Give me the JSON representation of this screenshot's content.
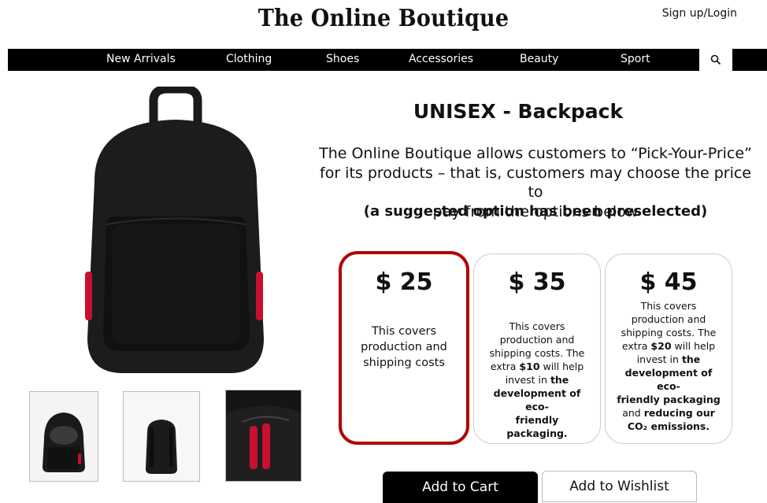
{
  "header": {
    "brand": "The Online Boutique",
    "signin": "Sign up/Login"
  },
  "nav": {
    "items": [
      "New Arrivals",
      "Clothing",
      "Shoes",
      "Accessories",
      "Beauty",
      "Sport"
    ],
    "search_icon": "search-icon"
  },
  "product": {
    "title": "UNISEX - Backpack",
    "description_line1": "The Online Boutique allows customers to “Pick-Your-Price”",
    "description_line2": "for its products – that is, customers may choose the price to",
    "description_line3": "pay from the options below",
    "note": "(a suggested option has been preselected)"
  },
  "price_options": [
    {
      "price": "$ 25",
      "line1": "This covers",
      "line2": "production and",
      "line3": "shipping costs",
      "selected": true
    },
    {
      "price": "$ 35",
      "l1": "This covers",
      "l2": "production and",
      "l3": "shipping costs. The",
      "l4a": "extra ",
      "l4b": "$10",
      "l4c": " will help",
      "l5a": "invest in ",
      "l5b": "the",
      "l6": "development of eco-",
      "l7": "friendly packaging.",
      "selected": false
    },
    {
      "price": "$ 45",
      "l1": "This covers",
      "l2": "production and",
      "l3": "shipping costs. The",
      "l4a": "extra ",
      "l4b": "$20",
      "l4c": " will help",
      "l5a": "invest in ",
      "l5b": "the",
      "l6": "development of eco-",
      "l7": "friendly packaging",
      "l8a": "and ",
      "l8b": "reducing our",
      "l9": "CO₂ emissions.",
      "selected": false
    }
  ],
  "buttons": {
    "add_to_cart": "Add to Cart",
    "add_to_wishlist": "Add to Wishlist"
  },
  "colors": {
    "selected_border": "#b10000",
    "navbar": "#000000",
    "backpack_accent": "#c8102e"
  }
}
